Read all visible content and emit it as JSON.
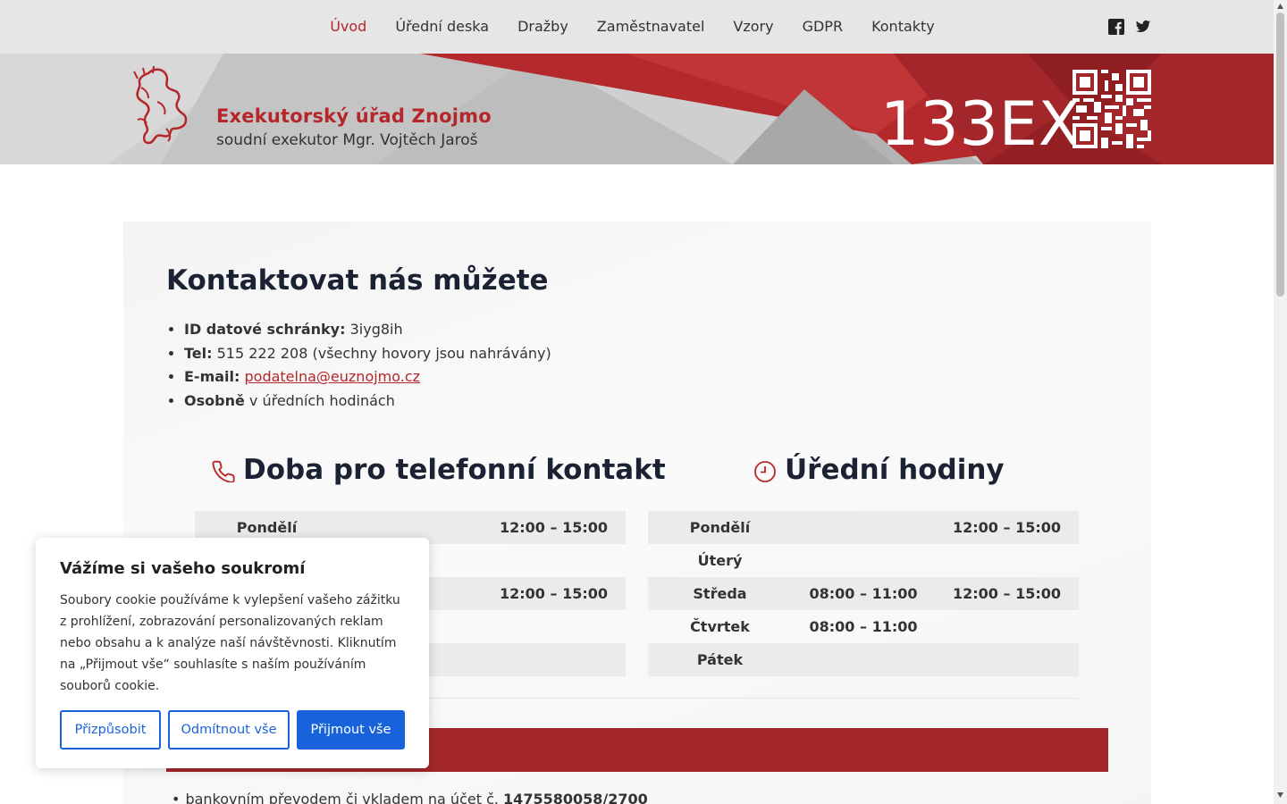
{
  "nav": {
    "items": [
      "Úvod",
      "Úřední deska",
      "Dražby",
      "Zaměstnavatel",
      "Vzory",
      "GDPR",
      "Kontakty"
    ],
    "active": "Úvod",
    "social": [
      "facebook-icon",
      "twitter-icon"
    ]
  },
  "banner": {
    "title": "Exekutorský úřad Znojmo",
    "subtitle": "soudní exekutor Mgr. Vojtěch Jaroš",
    "code": "133EX",
    "accent": "#b5262a"
  },
  "contact": {
    "heading": "Kontaktovat nás můžete",
    "items": [
      {
        "label": "ID datové schránky:",
        "value": "3iyg8ih"
      },
      {
        "label": "Tel:",
        "value": "515 222 208 (všechny hovory jsou nahrávány)"
      },
      {
        "label": "E-mail:",
        "value": "podatelna@euznojmo.cz"
      },
      {
        "label": "Osobně",
        "value": "v úředních hodinách"
      }
    ]
  },
  "phone_hours": {
    "heading": "Doba pro telefonní kontakt",
    "rows": [
      {
        "day": "Pondělí",
        "morning": "",
        "afternoon": "12:00 – 15:00"
      },
      {
        "day": "",
        "morning": "",
        "afternoon": ""
      },
      {
        "day": "",
        "morning": "1:00",
        "afternoon": "12:00 – 15:00"
      },
      {
        "day": "",
        "morning": "1:00",
        "afternoon": ""
      },
      {
        "day": "",
        "morning": "",
        "afternoon": ""
      }
    ]
  },
  "office_hours": {
    "heading": "Úřední hodiny",
    "rows": [
      {
        "day": "Pondělí",
        "morning": "",
        "afternoon": "12:00 – 15:00"
      },
      {
        "day": "Úterý",
        "morning": "",
        "afternoon": ""
      },
      {
        "day": "Středa",
        "morning": "08:00 – 11:00",
        "afternoon": "12:00 – 15:00"
      },
      {
        "day": "Čtvrtek",
        "morning": "08:00 – 11:00",
        "afternoon": ""
      },
      {
        "day": "Pátek",
        "morning": "",
        "afternoon": ""
      }
    ]
  },
  "payment": {
    "text": "bankovním převodem či vkladem na účet č.",
    "account": "1475580058/2700"
  },
  "cookie": {
    "title": "Vážíme si vašeho soukromí",
    "text": "Soubory cookie používáme k vylepšení vašeho zážitku z prohlížení, zobrazování personalizovaných reklam nebo obsahu a k analýze naší návštěvnosti. Kliknutím na „Přijmout vše“ souhlasíte s naším používáním souborů cookie.",
    "customize": "Přizpůsobit",
    "reject": "Odmítnout vše",
    "accept": "Přijmout vše",
    "button_color": "#1863dc"
  }
}
